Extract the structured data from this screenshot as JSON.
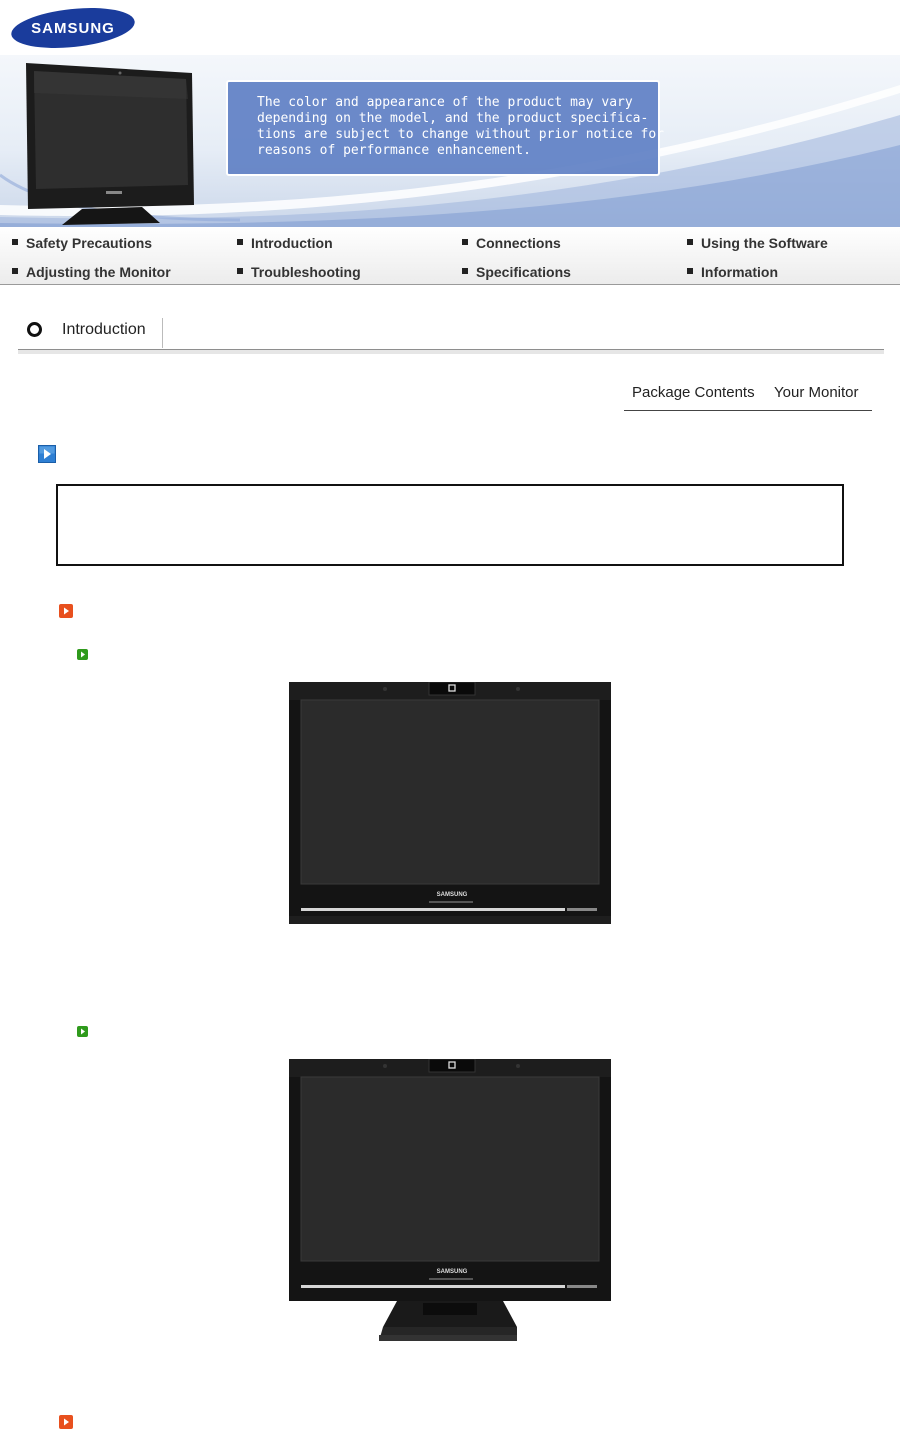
{
  "brand": {
    "logo_text": "SAMSUNG"
  },
  "banner": {
    "notice_lines": [
      "The color and appearance of the product may vary",
      "depending on the model, and the product specifica-",
      "tions are subject to change without prior notice for",
      "reasons of performance enhancement."
    ]
  },
  "nav": {
    "items": [
      {
        "label": "Safety Precautions"
      },
      {
        "label": "Introduction"
      },
      {
        "label": "Connections"
      },
      {
        "label": "Using the Software"
      },
      {
        "label": "Adjusting the Monitor"
      },
      {
        "label": "Troubleshooting"
      },
      {
        "label": "Specifications"
      },
      {
        "label": "Information"
      }
    ]
  },
  "section": {
    "title": "Introduction"
  },
  "subtabs": [
    {
      "label": "Package Contents"
    },
    {
      "label": "Your Monitor"
    }
  ],
  "colors": {
    "blue_arrow": "#2e7fd3",
    "orange_arrow": "#e8501e",
    "green_arrow": "#2f9a1c",
    "notice_box": "#6080c4"
  },
  "icons": {
    "section_marker": "ring-icon",
    "blue": "play-arrow-icon",
    "orange": "play-arrow-icon",
    "green": "play-arrow-icon"
  }
}
